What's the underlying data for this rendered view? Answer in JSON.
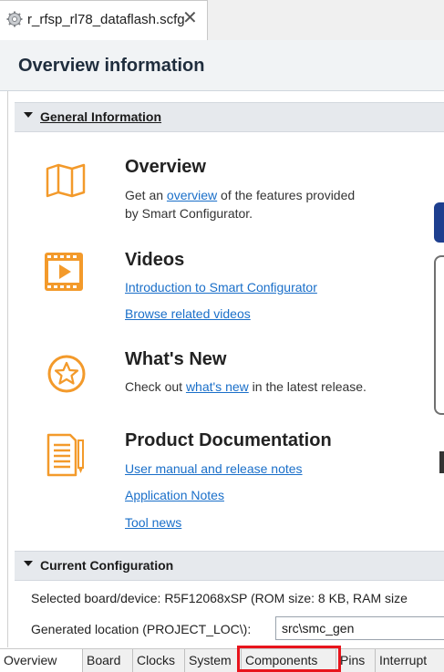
{
  "editor_tab": {
    "title": "r_rfsp_rl78_dataflash.scfg",
    "icon": "gear-icon",
    "close_symbol": "✕"
  },
  "header": {
    "title": "Overview information"
  },
  "general_section": {
    "label": "General Information",
    "items": {
      "overview": {
        "icon": "map-icon",
        "title": "Overview",
        "text_before": "Get an ",
        "link": "overview",
        "text_after": " of the features provided",
        "text_line2": "by Smart Configurator."
      },
      "videos": {
        "icon": "video-play-icon",
        "title": "Videos",
        "links": [
          "Introduction to Smart Configurator",
          "Browse related videos"
        ]
      },
      "whats_new": {
        "icon": "star-badge-icon",
        "title": "What's New",
        "text_before": "Check out ",
        "link": "what's new",
        "text_after": " in the latest release."
      },
      "documentation": {
        "icon": "document-pen-icon",
        "title": "Product Documentation",
        "links": [
          "User manual and release notes",
          "Application Notes",
          "Tool news"
        ]
      }
    }
  },
  "current_config": {
    "label": "Current Configuration",
    "board_line": "Selected board/device:  R5F12068xSP (ROM size: 8 KB, RAM size",
    "location_label": "Generated location (PROJECT_LOC\\):",
    "location_value": "src\\smc_gen"
  },
  "bottom_tabs": [
    "Overview",
    "Board",
    "Clocks",
    "System",
    "Components",
    "Pins",
    "Interrupt"
  ],
  "colors": {
    "accent_orange": "#f39a2b",
    "link_blue": "#1a6fc9",
    "highlight_red": "#e8141c"
  }
}
